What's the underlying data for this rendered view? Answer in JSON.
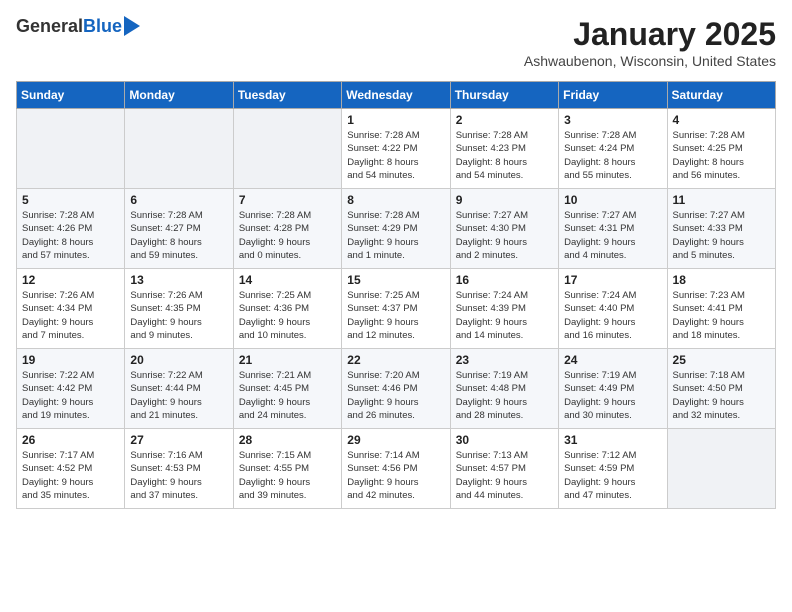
{
  "header": {
    "logo_general": "General",
    "logo_blue": "Blue",
    "title": "January 2025",
    "location": "Ashwaubenon, Wisconsin, United States"
  },
  "days_of_week": [
    "Sunday",
    "Monday",
    "Tuesday",
    "Wednesday",
    "Thursday",
    "Friday",
    "Saturday"
  ],
  "weeks": [
    [
      {
        "day": "",
        "info": ""
      },
      {
        "day": "",
        "info": ""
      },
      {
        "day": "",
        "info": ""
      },
      {
        "day": "1",
        "info": "Sunrise: 7:28 AM\nSunset: 4:22 PM\nDaylight: 8 hours\nand 54 minutes."
      },
      {
        "day": "2",
        "info": "Sunrise: 7:28 AM\nSunset: 4:23 PM\nDaylight: 8 hours\nand 54 minutes."
      },
      {
        "day": "3",
        "info": "Sunrise: 7:28 AM\nSunset: 4:24 PM\nDaylight: 8 hours\nand 55 minutes."
      },
      {
        "day": "4",
        "info": "Sunrise: 7:28 AM\nSunset: 4:25 PM\nDaylight: 8 hours\nand 56 minutes."
      }
    ],
    [
      {
        "day": "5",
        "info": "Sunrise: 7:28 AM\nSunset: 4:26 PM\nDaylight: 8 hours\nand 57 minutes."
      },
      {
        "day": "6",
        "info": "Sunrise: 7:28 AM\nSunset: 4:27 PM\nDaylight: 8 hours\nand 59 minutes."
      },
      {
        "day": "7",
        "info": "Sunrise: 7:28 AM\nSunset: 4:28 PM\nDaylight: 9 hours\nand 0 minutes."
      },
      {
        "day": "8",
        "info": "Sunrise: 7:28 AM\nSunset: 4:29 PM\nDaylight: 9 hours\nand 1 minute."
      },
      {
        "day": "9",
        "info": "Sunrise: 7:27 AM\nSunset: 4:30 PM\nDaylight: 9 hours\nand 2 minutes."
      },
      {
        "day": "10",
        "info": "Sunrise: 7:27 AM\nSunset: 4:31 PM\nDaylight: 9 hours\nand 4 minutes."
      },
      {
        "day": "11",
        "info": "Sunrise: 7:27 AM\nSunset: 4:33 PM\nDaylight: 9 hours\nand 5 minutes."
      }
    ],
    [
      {
        "day": "12",
        "info": "Sunrise: 7:26 AM\nSunset: 4:34 PM\nDaylight: 9 hours\nand 7 minutes."
      },
      {
        "day": "13",
        "info": "Sunrise: 7:26 AM\nSunset: 4:35 PM\nDaylight: 9 hours\nand 9 minutes."
      },
      {
        "day": "14",
        "info": "Sunrise: 7:25 AM\nSunset: 4:36 PM\nDaylight: 9 hours\nand 10 minutes."
      },
      {
        "day": "15",
        "info": "Sunrise: 7:25 AM\nSunset: 4:37 PM\nDaylight: 9 hours\nand 12 minutes."
      },
      {
        "day": "16",
        "info": "Sunrise: 7:24 AM\nSunset: 4:39 PM\nDaylight: 9 hours\nand 14 minutes."
      },
      {
        "day": "17",
        "info": "Sunrise: 7:24 AM\nSunset: 4:40 PM\nDaylight: 9 hours\nand 16 minutes."
      },
      {
        "day": "18",
        "info": "Sunrise: 7:23 AM\nSunset: 4:41 PM\nDaylight: 9 hours\nand 18 minutes."
      }
    ],
    [
      {
        "day": "19",
        "info": "Sunrise: 7:22 AM\nSunset: 4:42 PM\nDaylight: 9 hours\nand 19 minutes."
      },
      {
        "day": "20",
        "info": "Sunrise: 7:22 AM\nSunset: 4:44 PM\nDaylight: 9 hours\nand 21 minutes."
      },
      {
        "day": "21",
        "info": "Sunrise: 7:21 AM\nSunset: 4:45 PM\nDaylight: 9 hours\nand 24 minutes."
      },
      {
        "day": "22",
        "info": "Sunrise: 7:20 AM\nSunset: 4:46 PM\nDaylight: 9 hours\nand 26 minutes."
      },
      {
        "day": "23",
        "info": "Sunrise: 7:19 AM\nSunset: 4:48 PM\nDaylight: 9 hours\nand 28 minutes."
      },
      {
        "day": "24",
        "info": "Sunrise: 7:19 AM\nSunset: 4:49 PM\nDaylight: 9 hours\nand 30 minutes."
      },
      {
        "day": "25",
        "info": "Sunrise: 7:18 AM\nSunset: 4:50 PM\nDaylight: 9 hours\nand 32 minutes."
      }
    ],
    [
      {
        "day": "26",
        "info": "Sunrise: 7:17 AM\nSunset: 4:52 PM\nDaylight: 9 hours\nand 35 minutes."
      },
      {
        "day": "27",
        "info": "Sunrise: 7:16 AM\nSunset: 4:53 PM\nDaylight: 9 hours\nand 37 minutes."
      },
      {
        "day": "28",
        "info": "Sunrise: 7:15 AM\nSunset: 4:55 PM\nDaylight: 9 hours\nand 39 minutes."
      },
      {
        "day": "29",
        "info": "Sunrise: 7:14 AM\nSunset: 4:56 PM\nDaylight: 9 hours\nand 42 minutes."
      },
      {
        "day": "30",
        "info": "Sunrise: 7:13 AM\nSunset: 4:57 PM\nDaylight: 9 hours\nand 44 minutes."
      },
      {
        "day": "31",
        "info": "Sunrise: 7:12 AM\nSunset: 4:59 PM\nDaylight: 9 hours\nand 47 minutes."
      },
      {
        "day": "",
        "info": ""
      }
    ]
  ]
}
